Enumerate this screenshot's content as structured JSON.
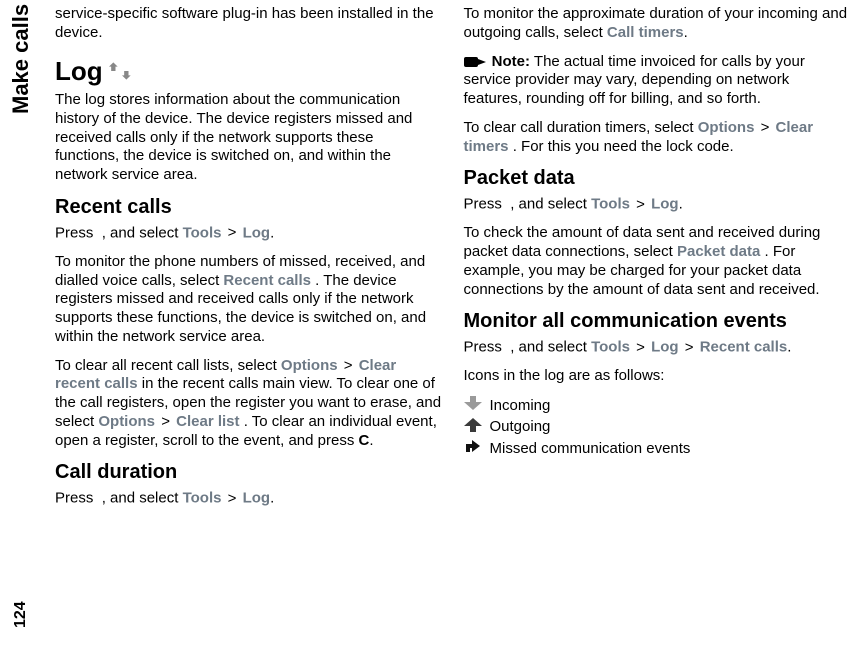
{
  "sidebar": {
    "tab": "Make calls",
    "page": "124"
  },
  "left": {
    "intro": "service-specific software plug-in has been installed in the device.",
    "log_h": "Log",
    "log_p": "The log stores information about the communication history of the device. The device registers missed and received calls only if the network supports these functions, the device is switched on, and within the network service area.",
    "recent_h": "Recent calls",
    "recent_p1a": "Press ",
    "recent_p1b": ", and select ",
    "recent_tools": "Tools",
    "recent_log": "Log",
    "recent_p2a": "To monitor the phone numbers of missed, received, and dialled voice calls, select ",
    "recent_calls": "Recent calls",
    "recent_p2b": ". The device registers missed and received calls only if the network supports these functions, the device is switched on, and within the network service area.",
    "recent_p3a": "To clear all recent call lists, select ",
    "options": "Options",
    "clear_recent": "Clear recent calls",
    "recent_p3b": " in the recent calls main view. To clear one of the call registers, open the register you want to erase, and select ",
    "clear_list": "Clear list",
    "recent_p3c": ". To clear an individual event, open a register, scroll to the event, and press ",
    "c_key": "C",
    "dur_h": "Call duration",
    "dur_p1a": "Press ",
    "dur_p1b": " , and select "
  },
  "right": {
    "dur_p2a": "To monitor the approximate duration of your incoming and outgoing calls, select ",
    "call_timers": "Call timers",
    "note_label": "Note:",
    "note_body": "  The actual time invoiced for calls by your service provider may vary, depending on network features, rounding off for billing, and so forth.",
    "clear_p_a": "To clear call duration timers, select ",
    "options": "Options",
    "clear_timers": "Clear timers",
    "clear_p_b": ". For this you need the lock code.",
    "pkt_h": "Packet data",
    "pkt_p1a": "Press ",
    "pkt_p1b": " , and select ",
    "tools": "Tools",
    "log": "Log",
    "pkt_p2a": "To check the amount of data sent and received during packet data connections, select ",
    "packet_data": "Packet data",
    "pkt_p2b": ". For example, you may be charged for your packet data connections by the amount of data sent and received.",
    "mon_h": "Monitor all communication events",
    "mon_p1a": "Press ",
    "mon_p1b": ", and select ",
    "recent_calls": "Recent calls",
    "icons_label": "Icons in the log are as follows:",
    "leg_in": "Incoming",
    "leg_out": "Outgoing",
    "leg_miss": "Missed communication events"
  },
  "gt": ">"
}
